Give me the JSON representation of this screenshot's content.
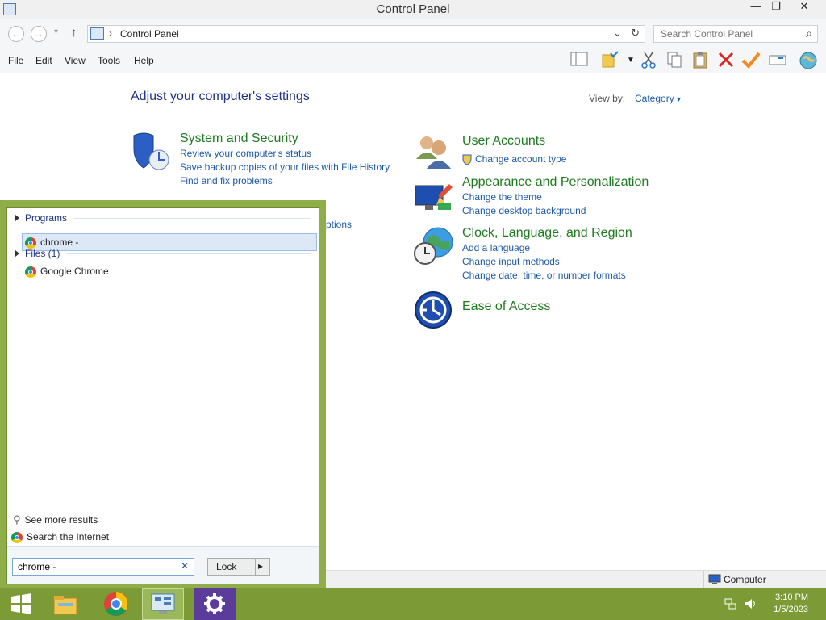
{
  "window": {
    "title": "Control Panel",
    "controls": {
      "minimize": "—",
      "maximize": "❐",
      "close": "✕"
    }
  },
  "nav": {
    "back": "←",
    "forward": "→",
    "recent": "▾",
    "up": "↑",
    "address_sep": "›",
    "address": "Control Panel",
    "dropdown": "⌄",
    "refresh": "↻",
    "search_placeholder": "Search Control Panel",
    "search_icon": "⌕"
  },
  "menu": [
    "File",
    "Edit",
    "View",
    "Tools",
    "Help"
  ],
  "toolbar": {
    "icons": [
      "layout-icon",
      "folder-options-icon",
      "cut-icon",
      "copy-icon",
      "paste-icon",
      "delete-icon",
      "properties-icon",
      "rename-icon",
      "globe-icon"
    ]
  },
  "main": {
    "heading": "Adjust your computer's settings",
    "view_by_label": "View by:",
    "view_by_value": "Category",
    "view_by_caret": "▾",
    "categories": [
      {
        "title": "System and Security",
        "icon": "shield-icon",
        "links": [
          "Review your computer's status",
          "Save backup copies of your files with File History",
          "Find and fix problems"
        ]
      },
      {
        "partial_link": "ptions"
      },
      {
        "title": "User Accounts",
        "icon": "users-icon",
        "links": [
          "Change account type"
        ]
      },
      {
        "title": "Appearance and Personalization",
        "icon": "display-icon",
        "links": [
          "Change the theme",
          "Change desktop background"
        ]
      },
      {
        "title": "Clock, Language, and Region",
        "icon": "clock-globe-icon",
        "links": [
          "Add a language",
          "Change input methods",
          "Change date, time, or number formats"
        ]
      },
      {
        "title": "Ease of Access",
        "icon": "ease-of-access-icon",
        "links": []
      }
    ]
  },
  "start_search": {
    "groups": [
      {
        "label": "Programs",
        "results": [
          "chrome -"
        ]
      },
      {
        "label": "Files (1)",
        "results": [
          "Google Chrome"
        ]
      }
    ],
    "see_more": "See more results",
    "search_internet": "Search the Internet",
    "query": "chrome -",
    "clear": "✕",
    "lock_label": "Lock",
    "lock_arrow": "▸"
  },
  "status_bar": {
    "computer": "Computer"
  },
  "taskbar": {
    "time": "3:10 PM",
    "date": "1/5/2023",
    "colors": {
      "taskbar": "#7c9a36",
      "panel_border": "#8fae4a",
      "link": "#1e5aa8",
      "category": "#1e7a1e"
    }
  }
}
